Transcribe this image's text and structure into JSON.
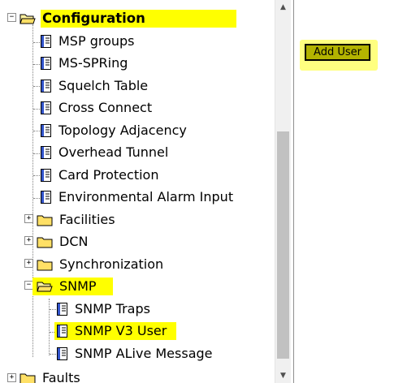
{
  "tree": {
    "configuration": {
      "label": "Configuration",
      "expander": "−"
    },
    "items": [
      {
        "label": "MSP groups"
      },
      {
        "label": "MS-SPRing"
      },
      {
        "label": "Squelch Table"
      },
      {
        "label": "Cross Connect"
      },
      {
        "label": "Topology Adjacency"
      },
      {
        "label": "Overhead Tunnel"
      },
      {
        "label": "Card Protection"
      },
      {
        "label": "Environmental Alarm Input"
      }
    ],
    "folders": [
      {
        "label": "Facilities",
        "expander": "+"
      },
      {
        "label": "DCN",
        "expander": "+"
      },
      {
        "label": "Synchronization",
        "expander": "+"
      }
    ],
    "snmp": {
      "label": "SNMP",
      "expander": "−",
      "children": [
        {
          "label": "SNMP Traps"
        },
        {
          "label": "SNMP V3 User"
        },
        {
          "label": "SNMP ALive Message"
        }
      ]
    },
    "next_item": {
      "label": "Faults",
      "expander": "+"
    }
  },
  "actions": {
    "add_user_label": "Add User"
  },
  "colors": {
    "highlight": "#ffff00",
    "button": "#b3b300"
  }
}
